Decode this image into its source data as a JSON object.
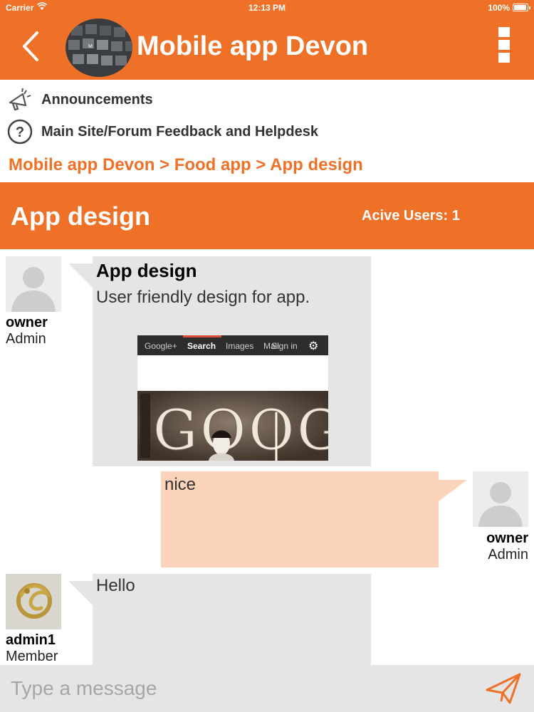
{
  "status_bar": {
    "carrier": "Carrier",
    "time": "12:13 PM",
    "battery_percent": "100%",
    "battery_level": 1.0
  },
  "header": {
    "title": "Mobile app Devon",
    "back_icon": "chevron-left-icon",
    "menu_icon": "vertical-menu-icon",
    "avatar_icon": "keyboard-photo"
  },
  "links": [
    {
      "icon": "megaphone-icon",
      "label": "Announcements"
    },
    {
      "icon": "help-circle-icon",
      "label": "Main Site/Forum Feedback and Helpdesk"
    }
  ],
  "breadcrumb": "Mobile app Devon > Food app > App design",
  "topic": {
    "title": "App design",
    "active_users": "Acive Users: 1"
  },
  "messages": [
    {
      "side": "left",
      "user": "owner",
      "role": "Admin",
      "title": "App design",
      "text": "User friendly design for app.",
      "attachment": {
        "nav_items": [
          "Google+",
          "Search",
          "Images",
          "Mail",
          "Sign in"
        ],
        "logo_letters": "GOOG"
      }
    },
    {
      "side": "right",
      "user": "owner",
      "role": "Admin",
      "text": "nice"
    },
    {
      "side": "left",
      "user": "admin1",
      "role": "Member",
      "text": "Hello"
    }
  ],
  "composer": {
    "placeholder": "Type a message",
    "send_icon": "send-icon"
  },
  "colors": {
    "brand_orange": "#ee7127",
    "bubble_gray": "#e5e5e6",
    "bubble_peach": "#fbd3ba"
  }
}
